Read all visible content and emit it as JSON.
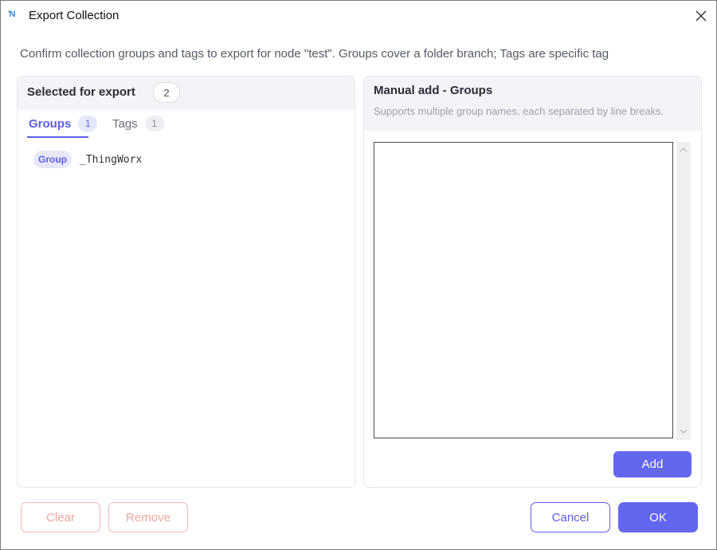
{
  "window": {
    "app_logo": "'N",
    "title": "Export Collection",
    "close_icon": "close-icon"
  },
  "description": "Confirm collection groups and tags to export for node \"test\". Groups cover a folder branch; Tags are specific tag",
  "selected_panel": {
    "title": "Selected for export",
    "total_count": "2",
    "tabs": [
      {
        "label": "Groups",
        "count": "1",
        "active": true
      },
      {
        "label": "Tags",
        "count": "1",
        "active": false
      }
    ],
    "items": [
      {
        "type_chip": "Group",
        "name": "_ThingWorx"
      }
    ]
  },
  "manual_panel": {
    "title": "Manual add - Groups",
    "subtitle": "Supports multiple group names, each separated by line breaks.",
    "textarea_value": "",
    "add_label": "Add"
  },
  "footer": {
    "clear_label": "Clear",
    "remove_label": "Remove",
    "cancel_label": "Cancel",
    "ok_label": "OK"
  },
  "colors": {
    "accent": "#6366ee",
    "danger_outline": "#f2b9b3",
    "panel_header_bg": "#f3f4f7"
  }
}
